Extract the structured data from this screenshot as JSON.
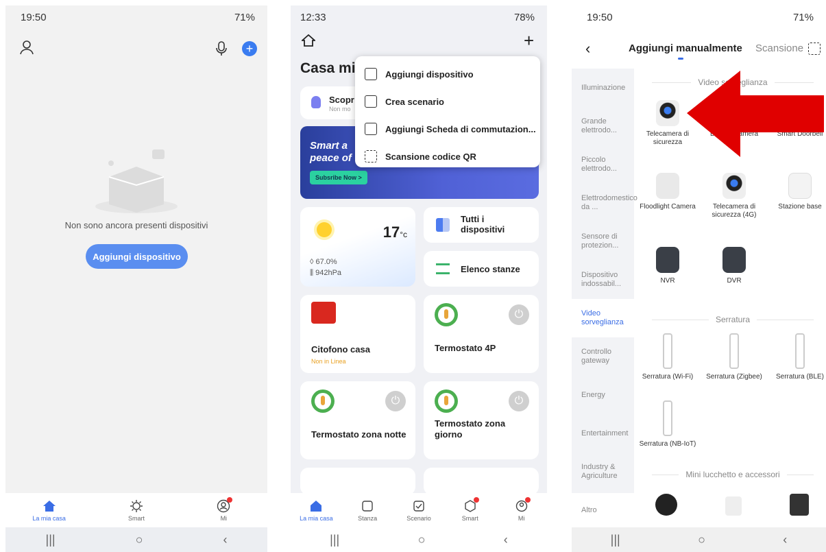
{
  "panel1": {
    "status_time": "19:50",
    "status_battery": "71%",
    "empty_text": "Non sono ancora presenti dispositivi",
    "add_button": "Aggiungi dispositivo",
    "tabs": [
      {
        "label": "La mia casa",
        "icon": "home-icon"
      },
      {
        "label": "Smart",
        "icon": "sun-icon"
      },
      {
        "label": "Mi",
        "icon": "profile-icon"
      }
    ]
  },
  "panel2": {
    "status_time": "12:33",
    "status_battery": "78%",
    "home_title": "Casa mi",
    "discover_title": "Scopr",
    "discover_sub": "Non mo",
    "menu": [
      "Aggiungi dispositivo",
      "Crea scenario",
      "Aggiungi Scheda di commutazion...",
      "Scansione codice QR"
    ],
    "banner_line1": "Smart a",
    "banner_line2": "peace of",
    "banner_button": "Subsribe Now >",
    "weather": {
      "temp": "17",
      "unit": "°c",
      "humidity": "67.0%",
      "pressure": "942hPa"
    },
    "all_devices": "Tutti i dispositivi",
    "rooms": "Elenco stanze",
    "devices": [
      {
        "name": "Citofono casa",
        "status": "Non in Linea"
      },
      {
        "name": "Termostato 4P"
      },
      {
        "name": "Termostato zona notte"
      },
      {
        "name": "Termostato zona giorno"
      }
    ],
    "tabs": [
      {
        "label": "La mia casa"
      },
      {
        "label": "Stanza"
      },
      {
        "label": "Scenario"
      },
      {
        "label": "Smart"
      },
      {
        "label": "Mi"
      }
    ]
  },
  "panel3": {
    "status_time": "19:50",
    "status_battery": "71%",
    "tab_manual": "Aggiungi manualmente",
    "tab_scan": "Scansione",
    "categories": [
      "Illuminazione",
      "Grande elettrodo...",
      "Piccolo elettrodo...",
      "Elettrodomestico da ...",
      "Sensore di protezion...",
      "Dispositivo indossabil...",
      "Video sorveglianza",
      "Controllo gateway",
      "Energy",
      "Entertainment",
      "Industry & Agriculture",
      "Altro"
    ],
    "section_video": "Video sorveglianza",
    "section_lock": "Serratura",
    "section_mini": "Mini lucchetto e accessori",
    "video_devices": [
      "Telecamera di sicurezza",
      "Battery Camera",
      "Smart Doorbell",
      "Floodlight Camera",
      "Telecamera di sicurezza (4G)",
      "Stazione base",
      "NVR",
      "DVR"
    ],
    "lock_devices": [
      "Serratura (Wi-Fi)",
      "Serratura (Zigbee)",
      "Serratura (BLE)",
      "Serratura (NB-IoT)"
    ],
    "accent": "#e00000"
  }
}
